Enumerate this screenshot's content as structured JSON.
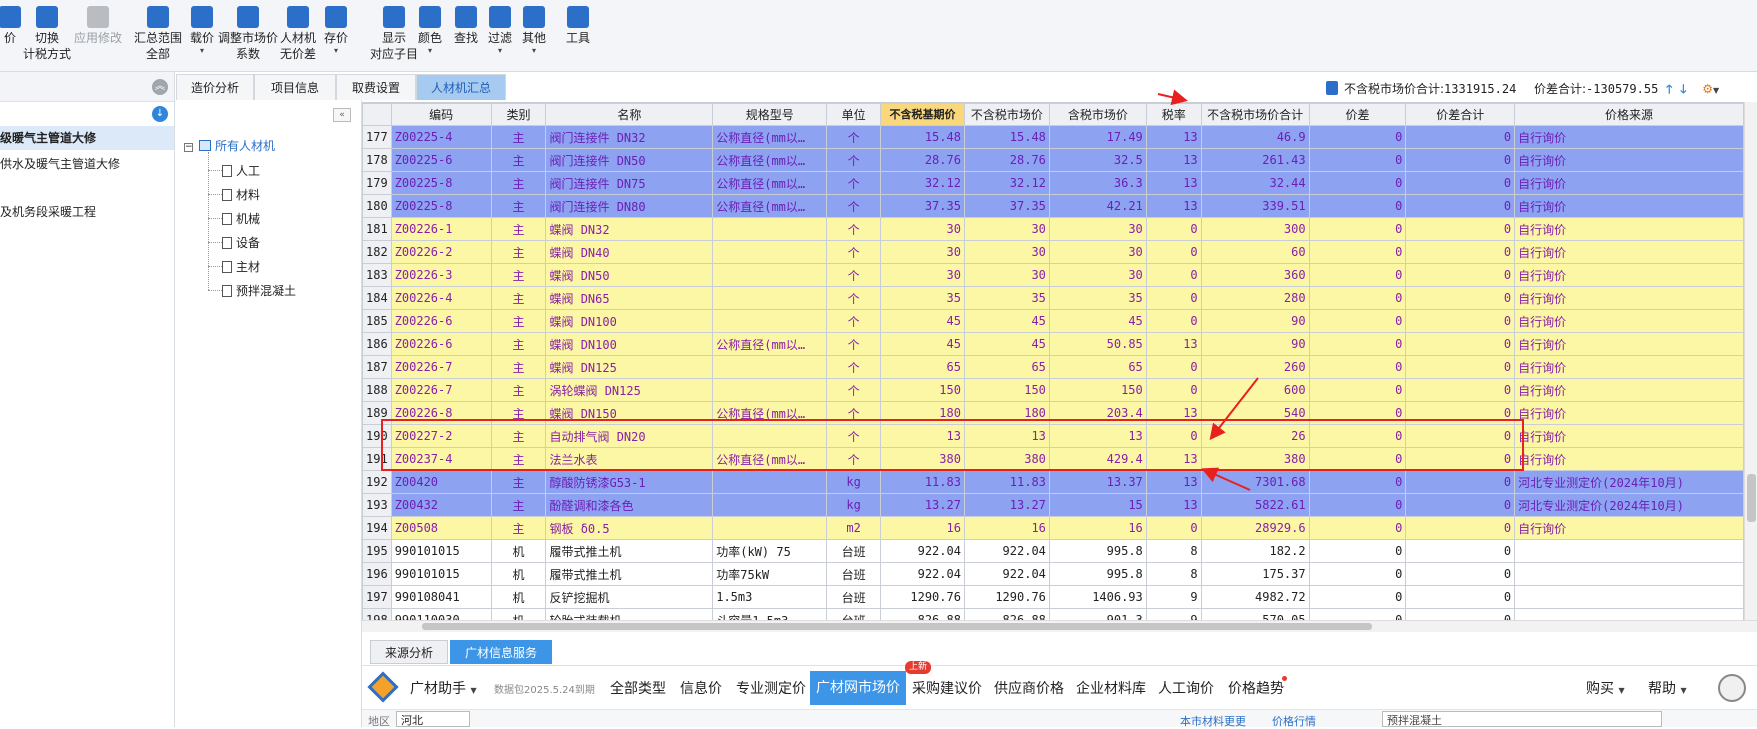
{
  "toolbar": {
    "items": [
      {
        "label": "价",
        "icon": "price-icon",
        "color": "#2b6fc9"
      },
      {
        "label": "切换\n计税方式",
        "icon": "switch-tax-icon",
        "color": "#2b6fc9"
      },
      {
        "label": "应用修改",
        "icon": "apply-changes-icon",
        "color": "#b9bcc0"
      },
      {
        "label": "汇总范围\n全部",
        "icon": "summary-scope-icon",
        "color": "#2b6fc9"
      },
      {
        "label": "载价",
        "icon": "load-price-icon",
        "color": "#2b6fc9"
      },
      {
        "label": "调整市场价\n系数",
        "icon": "adjust-coefficient-icon",
        "color": "#2b6fc9"
      },
      {
        "label": "人材机\n无价差",
        "icon": "balance-scale-icon",
        "color": "#2b6fc9"
      },
      {
        "label": "存价",
        "icon": "save-price-icon",
        "color": "#2b6fc9"
      },
      {
        "label": "显示\n对应子目",
        "icon": "show-subitem-icon",
        "color": "#2b6fc9"
      },
      {
        "label": "颜色",
        "icon": "color-icon",
        "color": "#2b6fc9"
      },
      {
        "label": "查找",
        "icon": "binoculars-icon",
        "color": "#2b6fc9"
      },
      {
        "label": "过滤",
        "icon": "filter-icon",
        "color": "#2b6fc9"
      },
      {
        "label": "其他",
        "icon": "grid-icon",
        "color": "#2b6fc9"
      },
      {
        "label": "工具",
        "icon": "tools-icon",
        "color": "#2b6fc9"
      }
    ]
  },
  "left_panel": {
    "items": [
      "级暖气主管道大修",
      "供水及暖气主管道大修",
      "",
      "及机务段采暖工程"
    ]
  },
  "tree": {
    "root": "所有人材机",
    "children": [
      "人工",
      "材料",
      "机械",
      "设备",
      "主材",
      "预拌混凝土"
    ]
  },
  "tabs": [
    "造价分析",
    "项目信息",
    "取费设置",
    "人材机汇总"
  ],
  "totals": {
    "market_total_label": "不含税市场价合计:",
    "market_total_value": "1331915.24",
    "diff_total_label": "价差合计:",
    "diff_total_value": "-130579.55"
  },
  "columns": [
    "",
    "编码",
    "类别",
    "名称",
    "规格型号",
    "单位",
    "不含税基期价",
    "不含税市场价",
    "含税市场价",
    "税率",
    "不含税市场价合计",
    "价差",
    "价差合计",
    "价格来源"
  ],
  "rows": [
    {
      "n": "177",
      "code": "Z00225-4",
      "cat": "主",
      "name": "阀门连接件 DN32",
      "spec": "公称直径(mm以…",
      "unit": "个",
      "base": "15.48",
      "mkt": "15.48",
      "taxmkt": "17.49",
      "rate": "13",
      "total": "46.9",
      "diff": "0",
      "difftotal": "0",
      "src": "自行询价",
      "style": "blue"
    },
    {
      "n": "178",
      "code": "Z00225-6",
      "cat": "主",
      "name": "阀门连接件 DN50",
      "spec": "公称直径(mm以…",
      "unit": "个",
      "base": "28.76",
      "mkt": "28.76",
      "taxmkt": "32.5",
      "rate": "13",
      "total": "261.43",
      "diff": "0",
      "difftotal": "0",
      "src": "自行询价",
      "style": "blue"
    },
    {
      "n": "179",
      "code": "Z00225-8",
      "cat": "主",
      "name": "阀门连接件 DN75",
      "spec": "公称直径(mm以…",
      "unit": "个",
      "base": "32.12",
      "mkt": "32.12",
      "taxmkt": "36.3",
      "rate": "13",
      "total": "32.44",
      "diff": "0",
      "difftotal": "0",
      "src": "自行询价",
      "style": "blue"
    },
    {
      "n": "180",
      "code": "Z00225-8",
      "cat": "主",
      "name": "阀门连接件 DN80",
      "spec": "公称直径(mm以…",
      "unit": "个",
      "base": "37.35",
      "mkt": "37.35",
      "taxmkt": "42.21",
      "rate": "13",
      "total": "339.51",
      "diff": "0",
      "difftotal": "0",
      "src": "自行询价",
      "style": "blue"
    },
    {
      "n": "181",
      "code": "Z00226-1",
      "cat": "主",
      "name": "蝶阀 DN32",
      "spec": "",
      "unit": "个",
      "base": "30",
      "mkt": "30",
      "taxmkt": "30",
      "rate": "0",
      "total": "300",
      "diff": "0",
      "difftotal": "0",
      "src": "自行询价",
      "style": "yellow"
    },
    {
      "n": "182",
      "code": "Z00226-2",
      "cat": "主",
      "name": "蝶阀 DN40",
      "spec": "",
      "unit": "个",
      "base": "30",
      "mkt": "30",
      "taxmkt": "30",
      "rate": "0",
      "total": "60",
      "diff": "0",
      "difftotal": "0",
      "src": "自行询价",
      "style": "yellow"
    },
    {
      "n": "183",
      "code": "Z00226-3",
      "cat": "主",
      "name": "蝶阀 DN50",
      "spec": "",
      "unit": "个",
      "base": "30",
      "mkt": "30",
      "taxmkt": "30",
      "rate": "0",
      "total": "360",
      "diff": "0",
      "difftotal": "0",
      "src": "自行询价",
      "style": "yellow"
    },
    {
      "n": "184",
      "code": "Z00226-4",
      "cat": "主",
      "name": "蝶阀 DN65",
      "spec": "",
      "unit": "个",
      "base": "35",
      "mkt": "35",
      "taxmkt": "35",
      "rate": "0",
      "total": "280",
      "diff": "0",
      "difftotal": "0",
      "src": "自行询价",
      "style": "yellow"
    },
    {
      "n": "185",
      "code": "Z00226-6",
      "cat": "主",
      "name": "蝶阀 DN100",
      "spec": "",
      "unit": "个",
      "base": "45",
      "mkt": "45",
      "taxmkt": "45",
      "rate": "0",
      "total": "90",
      "diff": "0",
      "difftotal": "0",
      "src": "自行询价",
      "style": "yellow"
    },
    {
      "n": "186",
      "code": "Z00226-6",
      "cat": "主",
      "name": "蝶阀 DN100",
      "spec": "公称直径(mm以…",
      "unit": "个",
      "base": "45",
      "mkt": "45",
      "taxmkt": "50.85",
      "rate": "13",
      "total": "90",
      "diff": "0",
      "difftotal": "0",
      "src": "自行询价",
      "style": "yellow"
    },
    {
      "n": "187",
      "code": "Z00226-7",
      "cat": "主",
      "name": "蝶阀 DN125",
      "spec": "",
      "unit": "个",
      "base": "65",
      "mkt": "65",
      "taxmkt": "65",
      "rate": "0",
      "total": "260",
      "diff": "0",
      "difftotal": "0",
      "src": "自行询价",
      "style": "yellow"
    },
    {
      "n": "188",
      "code": "Z00226-7",
      "cat": "主",
      "name": "涡轮蝶阀 DN125",
      "spec": "",
      "unit": "个",
      "base": "150",
      "mkt": "150",
      "taxmkt": "150",
      "rate": "0",
      "total": "600",
      "diff": "0",
      "difftotal": "0",
      "src": "自行询价",
      "style": "yellow"
    },
    {
      "n": "189",
      "code": "Z00226-8",
      "cat": "主",
      "name": "蝶阀 DN150",
      "spec": "公称直径(mm以…",
      "unit": "个",
      "base": "180",
      "mkt": "180",
      "taxmkt": "203.4",
      "rate": "13",
      "total": "540",
      "diff": "0",
      "difftotal": "0",
      "src": "自行询价",
      "style": "yellow"
    },
    {
      "n": "190",
      "code": "Z00227-2",
      "cat": "主",
      "name": "自动排气阀 DN20",
      "spec": "",
      "unit": "个",
      "base": "13",
      "mkt": "13",
      "taxmkt": "13",
      "rate": "0",
      "total": "26",
      "diff": "0",
      "difftotal": "0",
      "src": "自行询价",
      "style": "yellow"
    },
    {
      "n": "191",
      "code": "Z00237-4",
      "cat": "主",
      "name": "法兰水表",
      "spec": "公称直径(mm以…",
      "unit": "个",
      "base": "380",
      "mkt": "380",
      "taxmkt": "429.4",
      "rate": "13",
      "total": "380",
      "diff": "0",
      "difftotal": "0",
      "src": "自行询价",
      "style": "yellow"
    },
    {
      "n": "192",
      "code": "Z00420",
      "cat": "主",
      "name": "醇酸防锈漆G53-1",
      "spec": "",
      "unit": "kg",
      "base": "11.83",
      "mkt": "11.83",
      "taxmkt": "13.37",
      "rate": "13",
      "total": "7301.68",
      "diff": "0",
      "difftotal": "0",
      "src": "河北专业测定价(2024年10月)",
      "style": "blue"
    },
    {
      "n": "193",
      "code": "Z00432",
      "cat": "主",
      "name": "酚醛调和漆各色",
      "spec": "",
      "unit": "kg",
      "base": "13.27",
      "mkt": "13.27",
      "taxmkt": "15",
      "rate": "13",
      "total": "5822.61",
      "diff": "0",
      "difftotal": "0",
      "src": "河北专业测定价(2024年10月)",
      "style": "blue"
    },
    {
      "n": "194",
      "code": "Z00508",
      "cat": "主",
      "name": "钢板 δ0.5",
      "spec": "",
      "unit": "m2",
      "base": "16",
      "mkt": "16",
      "taxmkt": "16",
      "rate": "0",
      "total": "28929.6",
      "diff": "0",
      "difftotal": "0",
      "src": "自行询价",
      "style": "yellow"
    },
    {
      "n": "195",
      "code": "990101015",
      "cat": "机",
      "name": "履带式推土机",
      "spec": "功率(kW) 75",
      "unit": "台班",
      "base": "922.04",
      "mkt": "922.04",
      "taxmkt": "995.8",
      "rate": "8",
      "total": "182.2",
      "diff": "0",
      "difftotal": "0",
      "src": "",
      "style": "white"
    },
    {
      "n": "196",
      "code": "990101015",
      "cat": "机",
      "name": "履带式推土机",
      "spec": "功率75kW",
      "unit": "台班",
      "base": "922.04",
      "mkt": "922.04",
      "taxmkt": "995.8",
      "rate": "8",
      "total": "175.37",
      "diff": "0",
      "difftotal": "0",
      "src": "",
      "style": "white"
    },
    {
      "n": "197",
      "code": "990108041",
      "cat": "机",
      "name": "反铲挖掘机",
      "spec": "1.5m3",
      "unit": "台班",
      "base": "1290.76",
      "mkt": "1290.76",
      "taxmkt": "1406.93",
      "rate": "9",
      "total": "4982.72",
      "diff": "0",
      "difftotal": "0",
      "src": "",
      "style": "white"
    },
    {
      "n": "198",
      "code": "990110030",
      "cat": "机",
      "name": "轮胎式装载机",
      "spec": "斗容量1.5m3",
      "unit": "台班",
      "base": "826.88",
      "mkt": "826.88",
      "taxmkt": "901.3",
      "rate": "9",
      "total": "570.05",
      "diff": "0",
      "difftotal": "0",
      "src": "",
      "style": "white"
    }
  ],
  "bottom_tabs": [
    "来源分析",
    "广材信息服务"
  ],
  "bottom_bar": {
    "assistant": "广材助手",
    "package": "数据包2025.5.24到期",
    "items": [
      "全部类型",
      "信息价",
      "专业测定价",
      "广材网市场价",
      "采购建议价",
      "供应商价格",
      "企业材料库",
      "人工询价",
      "价格趋势"
    ],
    "new_badge": "上新",
    "buy": "购买",
    "help": "帮助"
  },
  "footer": {
    "region_label": "地区",
    "region_value": "河北",
    "link1": "本市材料更更",
    "link2": "价格行情",
    "search_placeholder": "预拌混凝土"
  }
}
